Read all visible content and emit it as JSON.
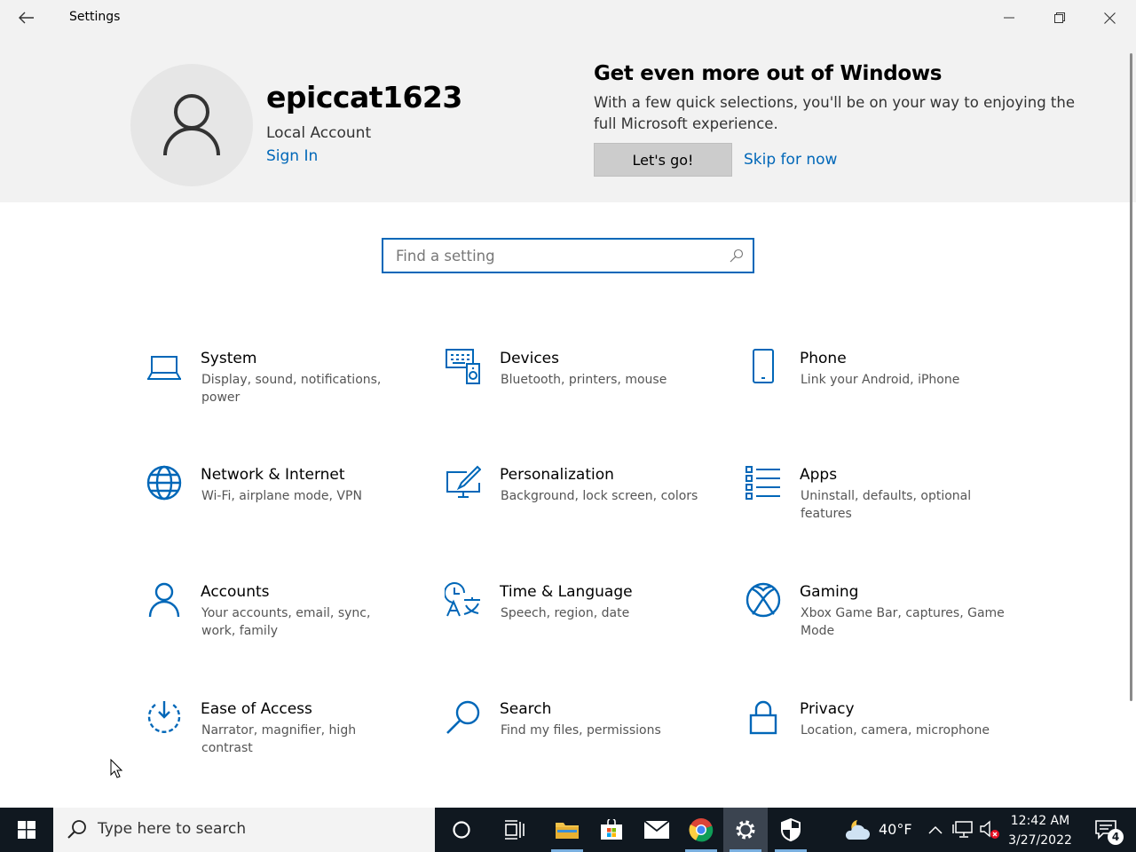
{
  "window": {
    "title": "Settings"
  },
  "header": {
    "username": "epiccat1623",
    "account_type": "Local Account",
    "sign_in_label": "Sign In",
    "promo_title": "Get even more out of Windows",
    "promo_body": "With a few quick selections, you'll be on your way to enjoying the full Microsoft experience.",
    "primary_button_label": "Let's go!",
    "secondary_link_label": "Skip for now"
  },
  "search": {
    "placeholder": "Find a setting"
  },
  "categories": [
    {
      "name": "System",
      "desc": "Display, sound, notifications, power",
      "icon": "laptop-icon"
    },
    {
      "name": "Devices",
      "desc": "Bluetooth, printers, mouse",
      "icon": "keyboard-speaker-icon"
    },
    {
      "name": "Phone",
      "desc": "Link your Android, iPhone",
      "icon": "phone-icon"
    },
    {
      "name": "Network & Internet",
      "desc": "Wi-Fi, airplane mode, VPN",
      "icon": "globe-icon"
    },
    {
      "name": "Personalization",
      "desc": "Background, lock screen, colors",
      "icon": "paint-monitor-icon"
    },
    {
      "name": "Apps",
      "desc": "Uninstall, defaults, optional features",
      "icon": "apps-list-icon"
    },
    {
      "name": "Accounts",
      "desc": "Your accounts, email, sync, work, family",
      "icon": "person-icon"
    },
    {
      "name": "Time & Language",
      "desc": "Speech, region, date",
      "icon": "time-language-icon"
    },
    {
      "name": "Gaming",
      "desc": "Xbox Game Bar, captures, Game Mode",
      "icon": "xbox-icon"
    },
    {
      "name": "Ease of Access",
      "desc": "Narrator, magnifier, high contrast",
      "icon": "ease-of-access-icon"
    },
    {
      "name": "Search",
      "desc": "Find my files, permissions",
      "icon": "magnifier-icon"
    },
    {
      "name": "Privacy",
      "desc": "Location, camera, microphone",
      "icon": "padlock-icon"
    }
  ],
  "taskbar": {
    "search_placeholder": "Type here to search",
    "temperature": "40°F",
    "time": "12:42 AM",
    "date": "3/27/2022",
    "notification_count": "4"
  },
  "colors": {
    "accent": "#0067b8",
    "header_bg": "#f2f2f2",
    "taskbar_bg": "#101820"
  }
}
